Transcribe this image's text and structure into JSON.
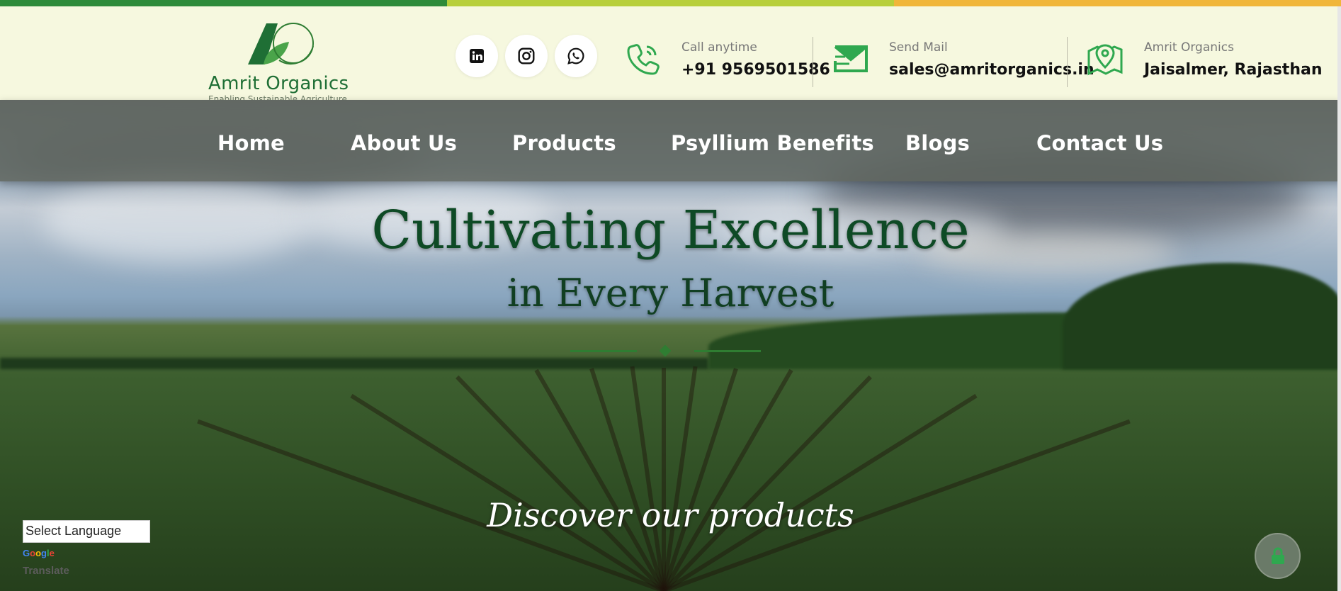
{
  "colors": {
    "stripe": [
      "#2e8b3a",
      "#b7cf3b",
      "#f0b63a"
    ],
    "brand_green": "#1f6f35",
    "header_bg": "#f6f8df",
    "accent_green": "#2fa84f"
  },
  "brand": {
    "name": "Amrit Organics",
    "tagline": "Enabling Sustainable Agriculture",
    "logo_icon": "ao-leaf-logo-icon"
  },
  "social": [
    {
      "icon": "linkedin-icon"
    },
    {
      "icon": "instagram-icon"
    },
    {
      "icon": "whatsapp-icon"
    }
  ],
  "contacts": {
    "phone": {
      "icon": "phone-icon",
      "label": "Call anytime",
      "value": "+91 9569501586"
    },
    "mail": {
      "icon": "mail-icon",
      "label": "Send Mail",
      "value": "sales@amritorganics.in"
    },
    "location": {
      "icon": "map-pin-icon",
      "label": "Amrit Organics",
      "value": "Jaisalmer, Rajasthan"
    }
  },
  "nav": {
    "items": [
      {
        "label": "Home"
      },
      {
        "label": "About Us"
      },
      {
        "label": "Products"
      },
      {
        "label": "Psyllium Benefits"
      },
      {
        "label": "Blogs"
      },
      {
        "label": "Contact Us"
      }
    ]
  },
  "hero": {
    "title": "Cultivating Excellence",
    "subtitle": "in Every Harvest",
    "cta": "Discover our products"
  },
  "translate": {
    "select_label": "Select Language",
    "powered_google": "Google",
    "powered_translate": "Translate"
  },
  "widget": {
    "icon": "lock-icon"
  }
}
